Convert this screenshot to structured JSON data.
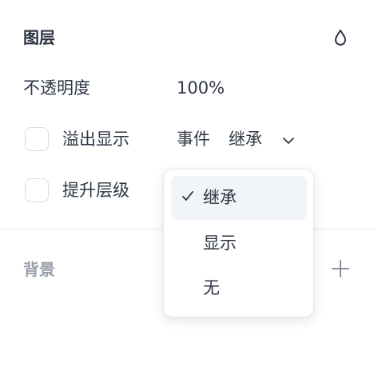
{
  "layer_section": {
    "title": "图层",
    "icon": "drop-icon"
  },
  "opacity": {
    "label": "不透明度",
    "value": "100%"
  },
  "overflow": {
    "label": "溢出显示",
    "checked": false,
    "event_label": "事件",
    "event_value": "继承"
  },
  "elevate": {
    "label": "提升层级",
    "checked": false
  },
  "dropdown": {
    "options": [
      {
        "label": "继承",
        "selected": true
      },
      {
        "label": "显示",
        "selected": false
      },
      {
        "label": "无",
        "selected": false
      }
    ]
  },
  "background_section": {
    "title": "背景",
    "add_icon": "plus-icon"
  }
}
